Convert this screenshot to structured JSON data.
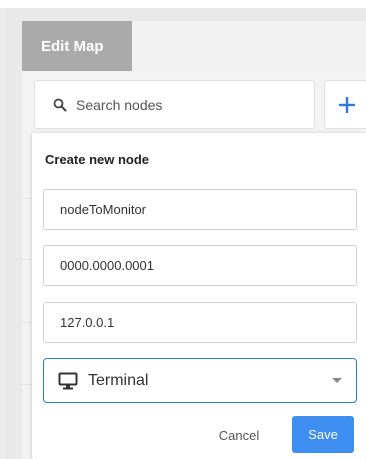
{
  "header": {
    "tab_label": "Edit Map"
  },
  "search": {
    "placeholder": "Search nodes",
    "icon": "search-icon"
  },
  "add_button": {
    "icon": "plus-icon",
    "color": "#2c7be5"
  },
  "create_node": {
    "title": "Create new node",
    "fields": {
      "name": "nodeToMonitor",
      "mac": "0000.0000.0001",
      "ip": "127.0.0.1"
    },
    "type_select": {
      "value": "Terminal",
      "icon": "monitor-icon"
    },
    "cancel_label": "Cancel",
    "save_label": "Save"
  },
  "colors": {
    "accent": "#3d8ef0",
    "tab_bg": "#aaaaaa"
  }
}
